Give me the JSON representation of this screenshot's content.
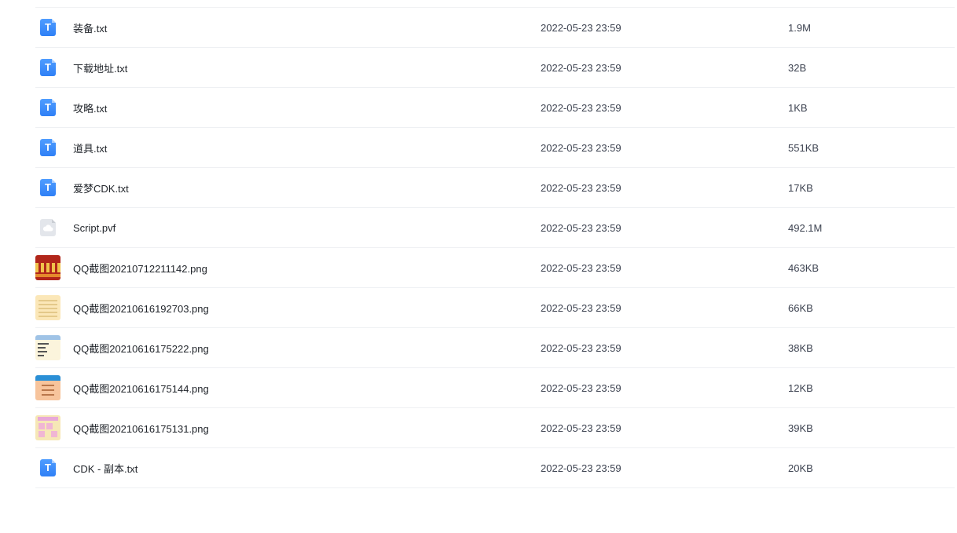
{
  "files": [
    {
      "name": "装备.txt",
      "date": "2022-05-23 23:59",
      "size": "1.9M",
      "icon": "txt-file-icon"
    },
    {
      "name": "下载地址.txt",
      "date": "2022-05-23 23:59",
      "size": "32B",
      "icon": "txt-file-icon"
    },
    {
      "name": "攻略.txt",
      "date": "2022-05-23 23:59",
      "size": "1KB",
      "icon": "txt-file-icon"
    },
    {
      "name": "道具.txt",
      "date": "2022-05-23 23:59",
      "size": "551KB",
      "icon": "txt-file-icon"
    },
    {
      "name": "爱梦CDK.txt",
      "date": "2022-05-23 23:59",
      "size": "17KB",
      "icon": "txt-file-icon"
    },
    {
      "name": "Script.pvf",
      "date": "2022-05-23 23:59",
      "size": "492.1M",
      "icon": "cloud-file-icon"
    },
    {
      "name": "QQ截图20210712211142.png",
      "date": "2022-05-23 23:59",
      "size": "463KB",
      "icon": "image-thumbnail"
    },
    {
      "name": "QQ截图20210616192703.png",
      "date": "2022-05-23 23:59",
      "size": "66KB",
      "icon": "image-thumbnail"
    },
    {
      "name": "QQ截图20210616175222.png",
      "date": "2022-05-23 23:59",
      "size": "38KB",
      "icon": "image-thumbnail"
    },
    {
      "name": "QQ截图20210616175144.png",
      "date": "2022-05-23 23:59",
      "size": "12KB",
      "icon": "image-thumbnail"
    },
    {
      "name": "QQ截图20210616175131.png",
      "date": "2022-05-23 23:59",
      "size": "39KB",
      "icon": "image-thumbnail"
    },
    {
      "name": "CDK - 副本.txt",
      "date": "2022-05-23 23:59",
      "size": "20KB",
      "icon": "txt-file-icon"
    }
  ],
  "colors": {
    "txt_icon": "#2f80f6",
    "row_divider": "#eef0f3",
    "text_primary": "#1f2329",
    "text_secondary": "#3c4250"
  }
}
